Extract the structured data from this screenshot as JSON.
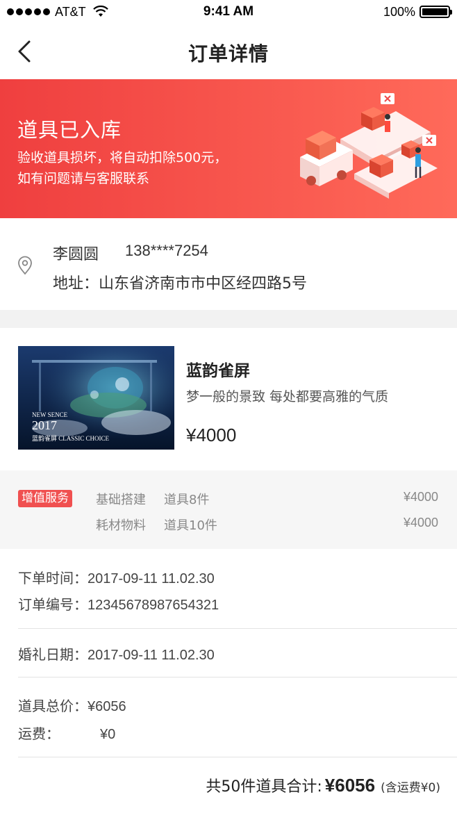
{
  "status_bar": {
    "carrier": "AT&T",
    "time": "9:41 AM",
    "battery": "100%"
  },
  "nav": {
    "title": "订单详情"
  },
  "banner": {
    "title": "道具已入库",
    "line1": "验收道具损坏，将自动扣除500元，",
    "line2": "如有问题请与客服联系"
  },
  "address": {
    "name": "李圆圆",
    "phone": "138****7254",
    "address": "地址：山东省济南市市中区经四路5号"
  },
  "product": {
    "name": "蓝韵雀屏",
    "description": "梦一般的景致 每处都要高雅的气质",
    "price": "¥4000",
    "image_caption_top": "NEW SENCE",
    "image_year": "2017",
    "image_caption_bottom": "蓝韵雀屏 CLASSIC CHOICE"
  },
  "services": {
    "tag": "增值服务",
    "items": [
      {
        "name": "基础搭建",
        "quantity": "道具8件",
        "price": "¥4000"
      },
      {
        "name": "耗材物料",
        "quantity": "道具10件",
        "price": "¥4000"
      }
    ]
  },
  "order_info": {
    "order_time_label": "下单时间：",
    "order_time": "2017-09-11 11.02.30",
    "order_number_label": "订单编号：",
    "order_number": "12345678987654321",
    "wedding_date_label": "婚礼日期：",
    "wedding_date": "2017-09-11 11.02.30",
    "total_price_label": "道具总价：",
    "total_price": "¥6056",
    "shipping_label": "运费：",
    "shipping": "¥0"
  },
  "summary": {
    "label": "共50件道具合计:",
    "total": "¥6056",
    "shipping_note": "(含运费¥0)"
  },
  "colors": {
    "banner_start": "#ef3f3f",
    "banner_end": "#ff6a5a",
    "tag": "#f05050"
  }
}
